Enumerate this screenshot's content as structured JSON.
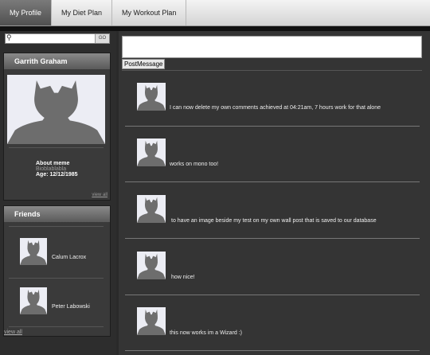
{
  "nav": {
    "tabs": [
      "My Profile",
      "My Diet Plan",
      "My Workout Plan"
    ]
  },
  "search": {
    "placeholder": "",
    "go_label": "GO"
  },
  "profile": {
    "name": "Garrith Graham",
    "about_title": "About meme",
    "about_sub": "Bioblablabla",
    "age": "Age: 12/12/1985",
    "view_all": "view all"
  },
  "friends": {
    "title": "Friends",
    "items": [
      {
        "name": "Calum Lacrox"
      },
      {
        "name": "Peter Labowski"
      }
    ],
    "view_all": "view all"
  },
  "composer": {
    "button_label": "PostMessage"
  },
  "posts": [
    {
      "text": "I can now delete my own comments achieved at 04:21am, 7 hours work for that alone"
    },
    {
      "text": "works on mono too!"
    },
    {
      "text": "to have an image beside my test on my own wall post that is saved to our database"
    },
    {
      "text": "how nice!"
    },
    {
      "text": "this now works im a Wizard :)"
    }
  ],
  "colors": {
    "background": "#2a2a2a",
    "panel": "#3a3a3a",
    "avatar_bg": "#ecedf4",
    "silhouette": "#6d6d6d"
  }
}
